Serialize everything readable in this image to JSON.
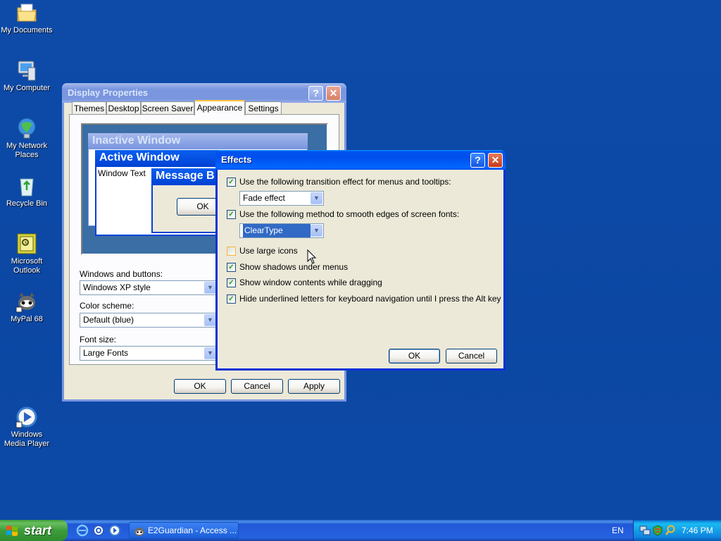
{
  "desktop": {
    "icons": [
      {
        "label": "My Documents",
        "icon": "folder-icon"
      },
      {
        "label": "My Computer",
        "icon": "computer-icon"
      },
      {
        "label": "My Network Places",
        "icon": "network-icon"
      },
      {
        "label": "Recycle Bin",
        "icon": "recycle-bin-icon"
      },
      {
        "label": "Microsoft Outlook",
        "icon": "outlook-icon"
      },
      {
        "label": "MyPal 68",
        "icon": "mypal-icon"
      },
      {
        "label": "Windows Media Player",
        "icon": "media-player-icon"
      }
    ]
  },
  "display_properties": {
    "title": "Display Properties",
    "help": "?",
    "close": "✕",
    "tabs": [
      "Themes",
      "Desktop",
      "Screen Saver",
      "Appearance",
      "Settings"
    ],
    "active_tab": "Appearance",
    "preview": {
      "inactive_title": "Inactive Window",
      "active_title": "Active Window",
      "window_text": "Window Text",
      "message_title": "Message B",
      "ok": "OK"
    },
    "windows_buttons_label": "Windows and buttons:",
    "windows_buttons_value": "Windows XP style",
    "color_scheme_label": "Color scheme:",
    "color_scheme_value": "Default (blue)",
    "font_size_label": "Font size:",
    "font_size_value": "Large Fonts",
    "ok": "OK",
    "cancel": "Cancel",
    "apply": "Apply"
  },
  "effects": {
    "title": "Effects",
    "help": "?",
    "close": "✕",
    "options": [
      {
        "label": "Use the following transition effect for menus and tooltips:",
        "checked": true
      },
      {
        "label": "Use the following method to smooth edges of screen fonts:",
        "checked": true
      },
      {
        "label": "Use large icons",
        "checked": false
      },
      {
        "label": "Show shadows under menus",
        "checked": true
      },
      {
        "label": "Show window contents while dragging",
        "checked": true
      },
      {
        "label": "Hide underlined letters for keyboard navigation until I press the Alt key",
        "checked": true
      }
    ],
    "transition_value": "Fade effect",
    "smoothing_value": "ClearType",
    "ok": "OK",
    "cancel": "Cancel"
  },
  "taskbar": {
    "start": "start",
    "task_label": "E2Guardian - Access ...",
    "language": "EN",
    "clock": "7:46 PM"
  },
  "colors": {
    "desktop": "#0d4aa6",
    "titlebar": "#0053ee",
    "dialog": "#ece9d8",
    "accent": "#ffc83c"
  }
}
